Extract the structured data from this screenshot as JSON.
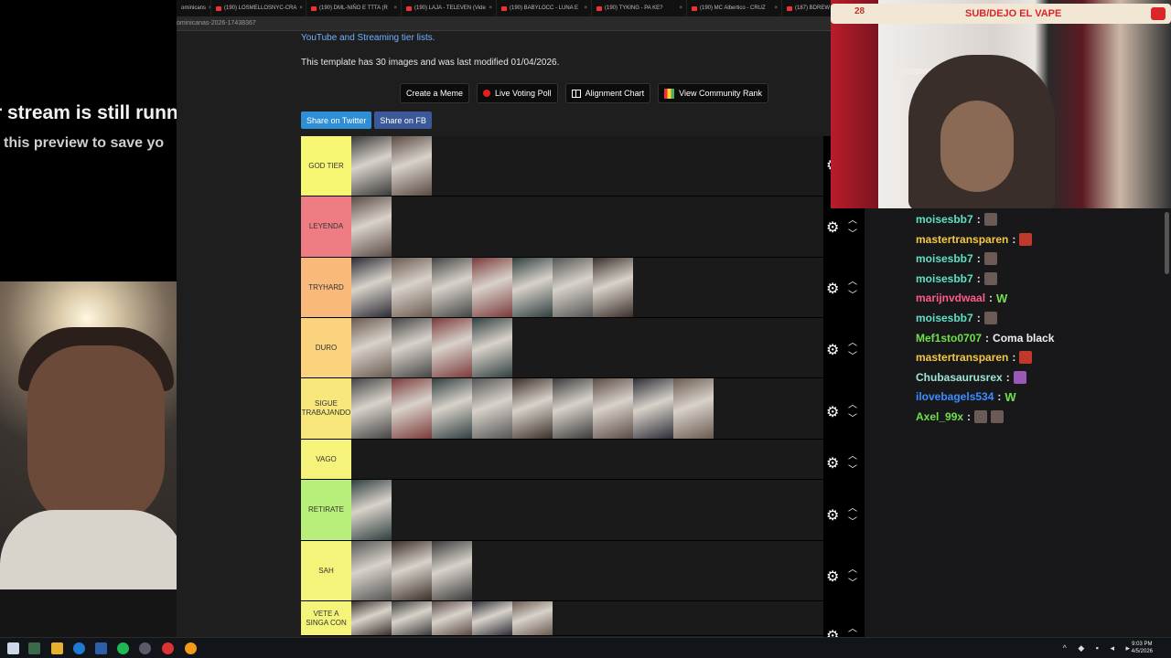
{
  "left_preview": {
    "line1": "r stream is still runn",
    "line2": " this preview to save yo"
  },
  "browser": {
    "tabs": [
      {
        "label": "ominicans"
      },
      {
        "label": "(190) LOSMELLOSNYC-CRA"
      },
      {
        "label": "(190) DML-NIÑO E TTTA (R"
      },
      {
        "label": "(190) LAJA - TELEVEN (Vide"
      },
      {
        "label": "(190) BABYLOCC - LUNA E"
      },
      {
        "label": "(190) TYKING - PA KE?"
      },
      {
        "label": "(190) MC Albertico - CRUZ"
      },
      {
        "label": "(187) BDREW"
      }
    ],
    "url": "ominicanas-2026-17438367",
    "intro_link": "YouTube and Streaming tier lists.",
    "intro_text": "This template has 30 images and was last modified 01/04/2026.",
    "buttons": {
      "create_meme": "Create a Meme",
      "live_voting": "Live Voting Poll",
      "alignment": "Alignment Chart",
      "community_rank": "View Community Rank"
    },
    "share": {
      "twitter": "Share on Twitter",
      "fb": "Share on FB"
    }
  },
  "tiers": [
    {
      "label": "GOD TIER",
      "color": "#f7f774",
      "items": 2
    },
    {
      "label": "LEYENDA",
      "color": "#ef7c82",
      "items": 1
    },
    {
      "label": "TRYHARD",
      "color": "#f8b97a",
      "items": 7
    },
    {
      "label": "DURO",
      "color": "#fbd37d",
      "items": 4
    },
    {
      "label": "SIGUE TRABAJANDO",
      "color": "#f8e77a",
      "items": 9
    },
    {
      "label": "VAGO",
      "color": "#f6f37a",
      "items": 0
    },
    {
      "label": "RETIRATE",
      "color": "#b8ef7a",
      "items": 1
    },
    {
      "label": "SAH",
      "color": "#f5f47a",
      "items": 3
    },
    {
      "label": "VETE A SINGA CON",
      "color": "#f5f47a",
      "items": 5
    }
  ],
  "stream_overlay": {
    "badge": "28",
    "title": "SUB/DEJO EL VAPE"
  },
  "chat": [
    {
      "user": "moisesbb7",
      "color": "#5fe0c5",
      "msg": "",
      "emotes": [
        "photo"
      ]
    },
    {
      "user": "mastertransparen",
      "color": "#f5c842",
      "msg": "",
      "emotes": [
        "red"
      ]
    },
    {
      "user": "moisesbb7",
      "color": "#5fe0c5",
      "msg": "",
      "emotes": [
        "photo"
      ]
    },
    {
      "user": "moisesbb7",
      "color": "#5fe0c5",
      "msg": "",
      "emotes": [
        "photo"
      ]
    },
    {
      "user": "marijnvdwaal",
      "color": "#ff5c8a",
      "msg": "",
      "emotes": [
        "w"
      ]
    },
    {
      "user": "moisesbb7",
      "color": "#5fe0c5",
      "msg": "",
      "emotes": [
        "photo"
      ]
    },
    {
      "user": "Mef1sto0707",
      "color": "#6fe04a",
      "msg": "Coma black",
      "emotes": []
    },
    {
      "user": "mastertransparen",
      "color": "#f5c842",
      "msg": "",
      "emotes": [
        "red"
      ]
    },
    {
      "user": "Chubasaurusrex",
      "color": "#9ee6d6",
      "msg": "",
      "emotes": [
        "pink"
      ]
    },
    {
      "user": "ilovebagels534",
      "color": "#3c8dff",
      "msg": "",
      "emotes": [
        "w"
      ]
    },
    {
      "user": "Axel_99x",
      "color": "#6fe04a",
      "msg": "",
      "emotes": [
        "photo",
        "photo"
      ]
    }
  ],
  "taskbar": {
    "time": "9:03 PM",
    "date": "4/5/2026"
  },
  "colors": {
    "youtube_red": "#e33333",
    "twitter_blue": "#2f8fd6",
    "fb_blue": "#3b5998",
    "link_blue": "#6fb1ff"
  }
}
